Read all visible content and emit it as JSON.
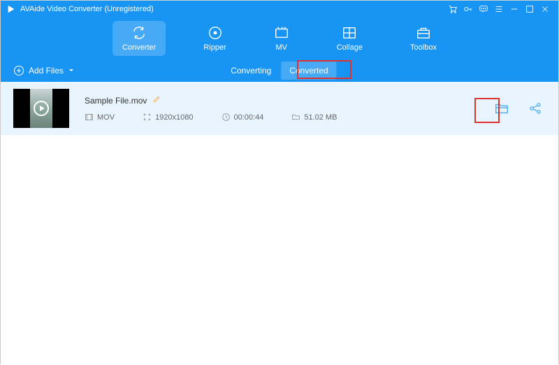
{
  "window": {
    "title": "AVAide Video Converter (Unregistered)"
  },
  "nav": {
    "converter": "Converter",
    "ripper": "Ripper",
    "mv": "MV",
    "collage": "Collage",
    "toolbox": "Toolbox"
  },
  "subbar": {
    "add_files": "Add Files",
    "tab_converting": "Converting",
    "tab_converted": "Converted"
  },
  "file": {
    "name": "Sample File.mov",
    "format": "MOV",
    "resolution": "1920x1080",
    "duration": "00:00:44",
    "size": "51.02 MB"
  }
}
